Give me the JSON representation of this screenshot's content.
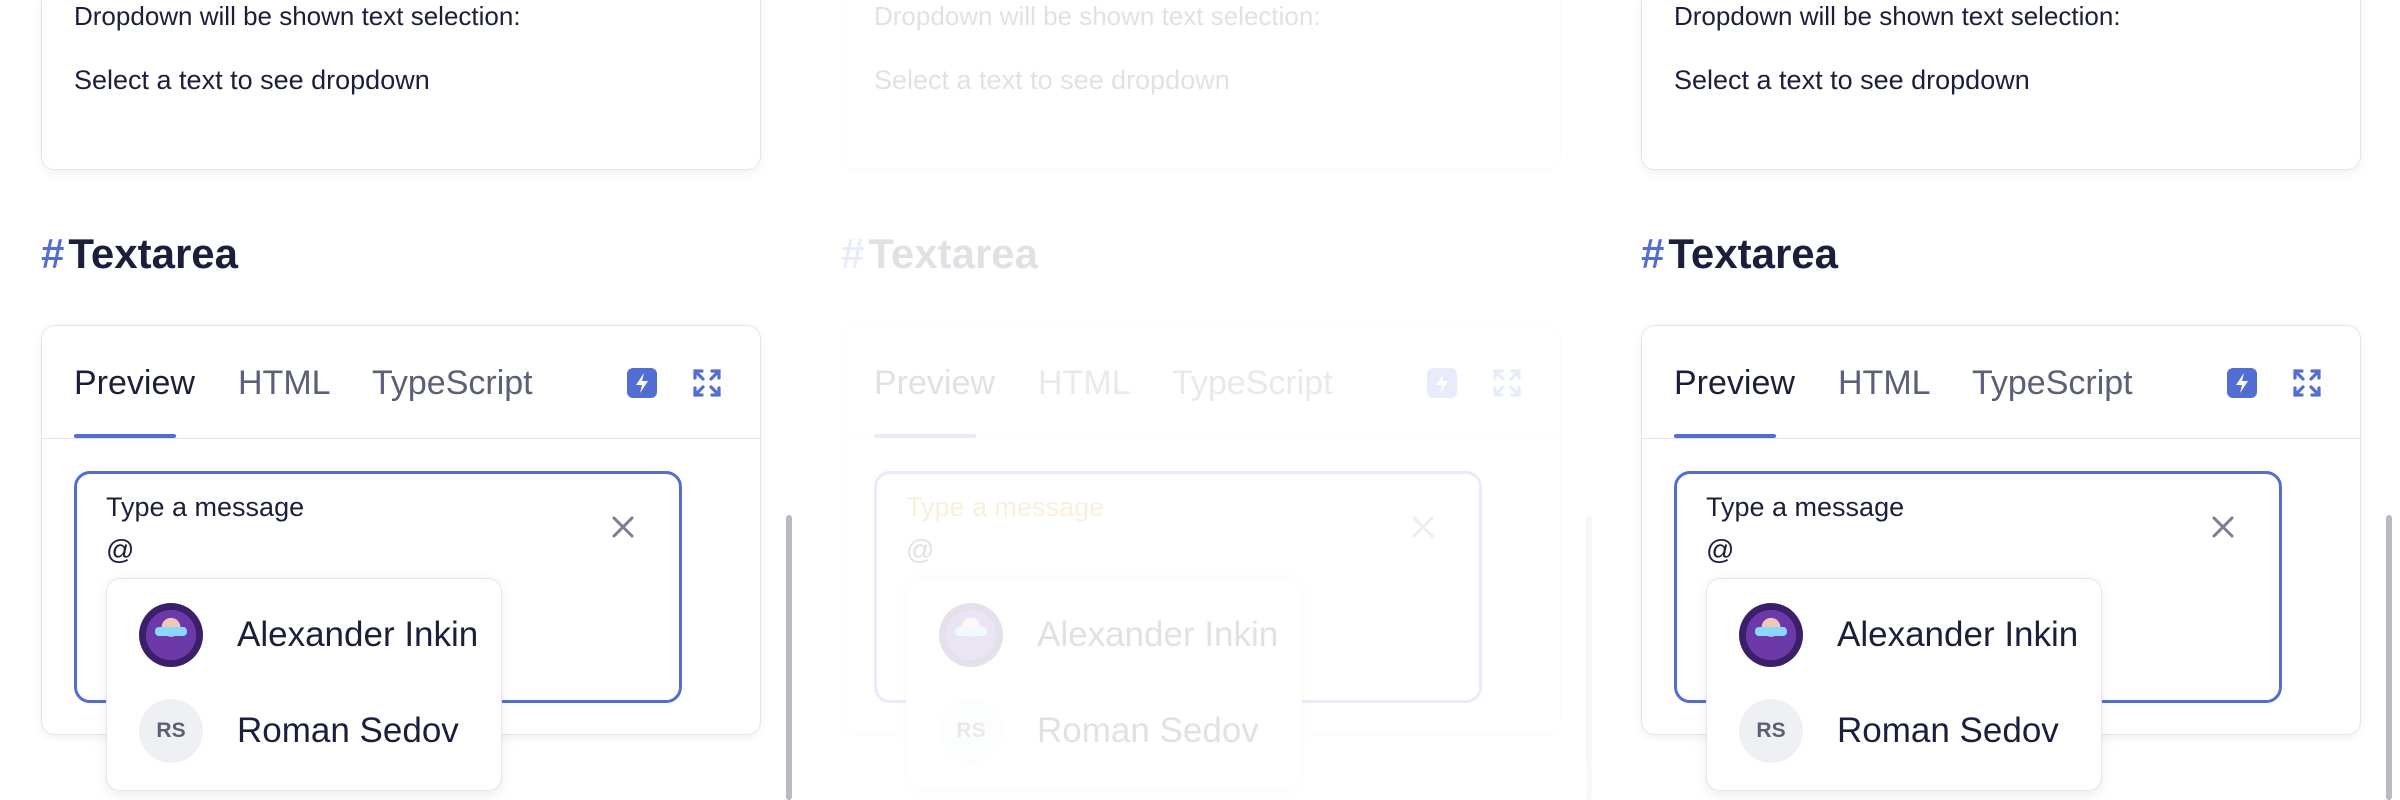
{
  "colors": {
    "accent": "#526ed3",
    "text": "#1b1f3b",
    "muted": "#5b5f77",
    "border": "#e4e6ef"
  },
  "panels": [
    {
      "selection_card": {
        "line1": "Dropdown will be shown text selection:",
        "line2": "Select a text to see dropdown"
      },
      "heading": {
        "hash": "#",
        "title": "Textarea"
      },
      "tabs": [
        {
          "label": "Preview",
          "active": true
        },
        {
          "label": "HTML",
          "active": false
        },
        {
          "label": "TypeScript",
          "active": false
        }
      ],
      "toolbar_icons": [
        "bolt-icon",
        "expand-icon"
      ],
      "textarea": {
        "label": "Type a message",
        "value": "@"
      },
      "dropdown": [
        {
          "name": "Alexander Inkin",
          "avatar": "photo"
        },
        {
          "name": "Roman Sedov",
          "initials": "RS"
        }
      ]
    },
    {
      "selection_card": {
        "line1": "Dropdown will be shown text selection:",
        "line2": "Select a text to see dropdown"
      },
      "heading": {
        "hash": "#",
        "title": "Textarea"
      },
      "tabs": [
        {
          "label": "Preview",
          "active": true
        },
        {
          "label": "HTML",
          "active": false
        },
        {
          "label": "TypeScript",
          "active": false
        }
      ],
      "toolbar_icons": [
        "bolt-icon",
        "expand-icon"
      ],
      "textarea": {
        "label": "Type a message",
        "value": "@"
      },
      "dropdown": [
        {
          "name": "Alexander Inkin",
          "avatar": "photo"
        },
        {
          "name": "Roman Sedov",
          "initials": "RS"
        }
      ]
    },
    {
      "selection_card": {
        "line1": "Dropdown will be shown text selection:",
        "line2": "Select a text to see dropdown"
      },
      "heading": {
        "hash": "#",
        "title": "Textarea"
      },
      "tabs": [
        {
          "label": "Preview",
          "active": true
        },
        {
          "label": "HTML",
          "active": false
        },
        {
          "label": "TypeScript",
          "active": false
        }
      ],
      "toolbar_icons": [
        "bolt-icon",
        "expand-icon"
      ],
      "textarea": {
        "label": "Type a message",
        "value": "@"
      },
      "dropdown": [
        {
          "name": "Alexander Inkin",
          "avatar": "photo"
        },
        {
          "name": "Roman Sedov",
          "initials": "RS"
        }
      ]
    }
  ]
}
